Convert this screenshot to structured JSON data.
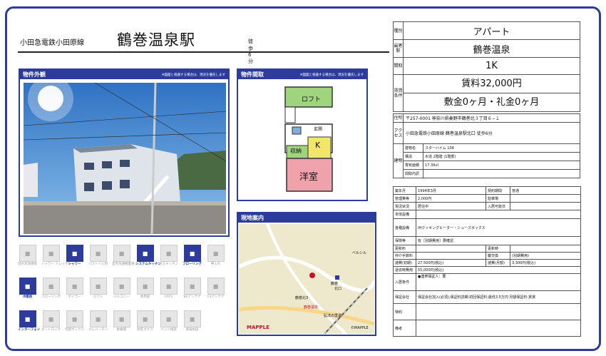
{
  "header": {
    "line": "小田急電鉄小田原線",
    "station": "鶴巻温泉駅",
    "walk": "徒歩6分"
  },
  "photo": {
    "title": "物件外観",
    "note": "※図面と相違する場合は、現況を優先します"
  },
  "plan": {
    "title": "物件間取",
    "note": "※図面と相違する場合は、現況を優先します",
    "loft": "ロフト",
    "entrance": "玄関",
    "storage": "収納",
    "kitchen": "K",
    "room": "洋室"
  },
  "map": {
    "title": "現地案内",
    "logo": "MAPPLE",
    "copyright": "©MAPPLE",
    "labels": [
      "鶴巻北3",
      "鶴巻温泉",
      "ベルシル",
      "鶴巻",
      "北口",
      "弘法の里湯"
    ]
  },
  "equipment": [
    {
      "label": "温水洗浄便座",
      "on": false
    },
    {
      "label": "シャワー ドレッサー",
      "on": false
    },
    {
      "label": "シャワー",
      "on": true
    },
    {
      "label": "バストイレ別",
      "on": false
    },
    {
      "label": "室内洗濯機置場",
      "on": false
    },
    {
      "label": "システムキッチン",
      "on": true
    },
    {
      "label": "ガスキッチン",
      "on": false
    },
    {
      "label": "フローリング",
      "on": true
    },
    {
      "label": "押入れ",
      "on": false
    },
    {
      "label": "冷暖房",
      "on": true
    },
    {
      "label": "フローリング",
      "on": false
    },
    {
      "label": "ボイラー",
      "on": false
    },
    {
      "label": "ロフト",
      "on": false
    },
    {
      "label": "バルコニー",
      "on": false
    },
    {
      "label": "専用庭",
      "on": false
    },
    {
      "label": "CATV",
      "on": false
    },
    {
      "label": "BSアンテナ",
      "on": false
    },
    {
      "label": "CSアンテナ",
      "on": false
    },
    {
      "label": "インターフォン",
      "on": true
    },
    {
      "label": "オートロック",
      "on": false
    },
    {
      "label": "宅配ボックス",
      "on": false
    },
    {
      "label": "エレベーター",
      "on": false
    },
    {
      "label": "駐輪場",
      "on": false
    },
    {
      "label": "防犯カメラ",
      "on": false
    },
    {
      "label": "ペット相談",
      "on": false
    },
    {
      "label": "楽器相談",
      "on": false
    }
  ],
  "info": {
    "type_label": "種別",
    "type": "アパート",
    "station_label": "最寄駅",
    "station": "鶴巻温泉",
    "layout_label": "間取",
    "layout": "1K",
    "rent_label": "賃貸条件",
    "rent": "賃料32,000円",
    "deposit": "敷金0ヶ月・礼金0ヶ月",
    "address_label": "住所",
    "address": "〒257-0001 神奈川県秦野市鶴巻北３丁目６−１",
    "access_label": "アクセス",
    "access": "小田急電鉄小田原線 鶴巻温泉駅北口 徒歩6分",
    "building_label": "建物",
    "bname_label": "建物名",
    "bname": "スターハイム 104",
    "struct_label": "構造",
    "struct": "木造 2階建 (1階部)",
    "area_label": "専有面積",
    "area": "17.39㎡",
    "dir_label": "間取内訳",
    "dir": "",
    "built_label": "築年月",
    "built": "1994年3月",
    "contract_label": "契約期間",
    "contract": "普通",
    "mgmt_label": "管理費等",
    "mgmt": "2,000円",
    "parking_label": "駐車場",
    "parking": "",
    "status_label": "現況状況",
    "status": "居住中",
    "movein_label": "入居可能日",
    "movein": "",
    "equip_label": "本体設備",
    "equip": "",
    "other_label": "各種設備",
    "other": "IHクッキングヒーター・シューズボックス",
    "ins_label": "保険等",
    "ins": "有［別期費用］要確認",
    "renew_label": "更新料",
    "renew": "",
    "renew2_label": "更新時",
    "renew2": "",
    "broker_label": "仲介手数料",
    "broker": "",
    "key_label": "鍵交換",
    "key": "(別期費用)",
    "initial_label": "諸費(初期)",
    "initial": "27,500円(税込)",
    "monthly_label": "諸費(月額)",
    "monthly": "3,300円(税込)",
    "leave_label": "退去時費用",
    "leave": "55,000円(税込)",
    "cond_label": "入居条件",
    "cond": "●連帯保証人：要",
    "guar_label": "保証会社",
    "guar": "保証会社加入(必須),保証料詳細:初回保証料:最低3.5万円 月額保証料:賃賃",
    "special_label": "特約",
    "special": "",
    "remarks_label": "備考",
    "remarks": ""
  }
}
